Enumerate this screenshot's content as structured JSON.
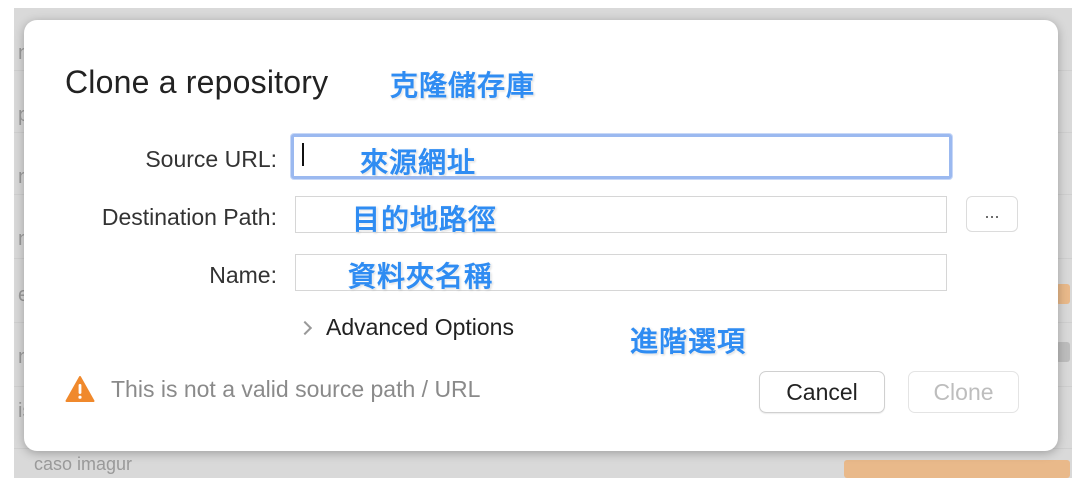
{
  "backdrop": {
    "edge_glyphs": [
      "n",
      "p",
      "n",
      "n",
      "e",
      "n",
      "is"
    ],
    "bottom_text": "caso imagur"
  },
  "dialog": {
    "title": "Clone a repository",
    "title_callout": "克隆儲存庫",
    "fields": {
      "source_url": {
        "label": "Source URL:",
        "value": "",
        "callout": "來源網址"
      },
      "destination_path": {
        "label": "Destination Path:",
        "value": "",
        "callout": "目的地路徑"
      },
      "name": {
        "label": "Name:",
        "value": "",
        "callout": "資料夾名稱"
      }
    },
    "browse_button": "...",
    "advanced_options": {
      "label": "Advanced Options",
      "callout": "進階選項"
    },
    "warning": {
      "icon": "warning-triangle-icon",
      "text": "This is not a valid source path / URL"
    },
    "buttons": {
      "cancel": "Cancel",
      "clone": "Clone"
    }
  },
  "colors": {
    "accent": "#2f8cf2",
    "focus_ring": "#9bb9f0",
    "warning": "#f0892c",
    "disabled_text": "#bdbdbd"
  }
}
